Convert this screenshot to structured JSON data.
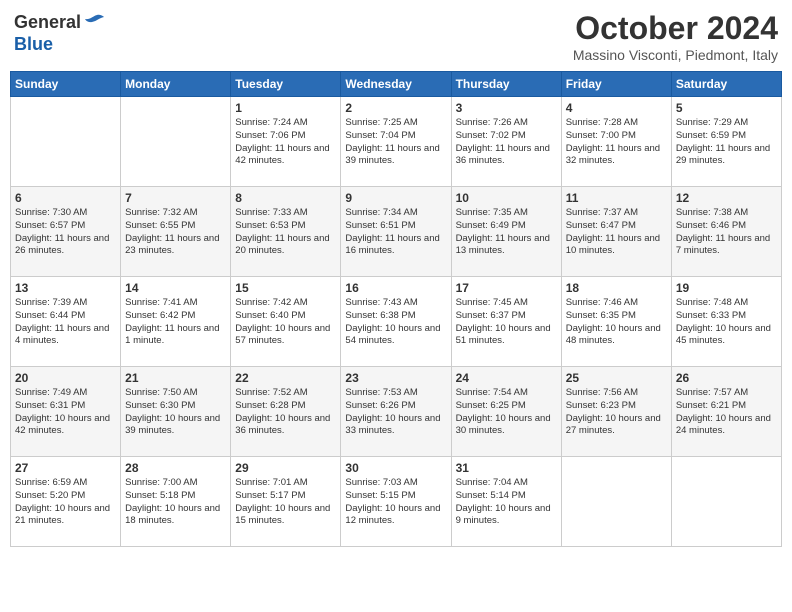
{
  "header": {
    "logo_general": "General",
    "logo_blue": "Blue",
    "month_title": "October 2024",
    "location": "Massino Visconti, Piedmont, Italy"
  },
  "weekdays": [
    "Sunday",
    "Monday",
    "Tuesday",
    "Wednesday",
    "Thursday",
    "Friday",
    "Saturday"
  ],
  "weeks": [
    [
      {
        "day": "",
        "info": ""
      },
      {
        "day": "",
        "info": ""
      },
      {
        "day": "1",
        "info": "Sunrise: 7:24 AM\nSunset: 7:06 PM\nDaylight: 11 hours and 42 minutes."
      },
      {
        "day": "2",
        "info": "Sunrise: 7:25 AM\nSunset: 7:04 PM\nDaylight: 11 hours and 39 minutes."
      },
      {
        "day": "3",
        "info": "Sunrise: 7:26 AM\nSunset: 7:02 PM\nDaylight: 11 hours and 36 minutes."
      },
      {
        "day": "4",
        "info": "Sunrise: 7:28 AM\nSunset: 7:00 PM\nDaylight: 11 hours and 32 minutes."
      },
      {
        "day": "5",
        "info": "Sunrise: 7:29 AM\nSunset: 6:59 PM\nDaylight: 11 hours and 29 minutes."
      }
    ],
    [
      {
        "day": "6",
        "info": "Sunrise: 7:30 AM\nSunset: 6:57 PM\nDaylight: 11 hours and 26 minutes."
      },
      {
        "day": "7",
        "info": "Sunrise: 7:32 AM\nSunset: 6:55 PM\nDaylight: 11 hours and 23 minutes."
      },
      {
        "day": "8",
        "info": "Sunrise: 7:33 AM\nSunset: 6:53 PM\nDaylight: 11 hours and 20 minutes."
      },
      {
        "day": "9",
        "info": "Sunrise: 7:34 AM\nSunset: 6:51 PM\nDaylight: 11 hours and 16 minutes."
      },
      {
        "day": "10",
        "info": "Sunrise: 7:35 AM\nSunset: 6:49 PM\nDaylight: 11 hours and 13 minutes."
      },
      {
        "day": "11",
        "info": "Sunrise: 7:37 AM\nSunset: 6:47 PM\nDaylight: 11 hours and 10 minutes."
      },
      {
        "day": "12",
        "info": "Sunrise: 7:38 AM\nSunset: 6:46 PM\nDaylight: 11 hours and 7 minutes."
      }
    ],
    [
      {
        "day": "13",
        "info": "Sunrise: 7:39 AM\nSunset: 6:44 PM\nDaylight: 11 hours and 4 minutes."
      },
      {
        "day": "14",
        "info": "Sunrise: 7:41 AM\nSunset: 6:42 PM\nDaylight: 11 hours and 1 minute."
      },
      {
        "day": "15",
        "info": "Sunrise: 7:42 AM\nSunset: 6:40 PM\nDaylight: 10 hours and 57 minutes."
      },
      {
        "day": "16",
        "info": "Sunrise: 7:43 AM\nSunset: 6:38 PM\nDaylight: 10 hours and 54 minutes."
      },
      {
        "day": "17",
        "info": "Sunrise: 7:45 AM\nSunset: 6:37 PM\nDaylight: 10 hours and 51 minutes."
      },
      {
        "day": "18",
        "info": "Sunrise: 7:46 AM\nSunset: 6:35 PM\nDaylight: 10 hours and 48 minutes."
      },
      {
        "day": "19",
        "info": "Sunrise: 7:48 AM\nSunset: 6:33 PM\nDaylight: 10 hours and 45 minutes."
      }
    ],
    [
      {
        "day": "20",
        "info": "Sunrise: 7:49 AM\nSunset: 6:31 PM\nDaylight: 10 hours and 42 minutes."
      },
      {
        "day": "21",
        "info": "Sunrise: 7:50 AM\nSunset: 6:30 PM\nDaylight: 10 hours and 39 minutes."
      },
      {
        "day": "22",
        "info": "Sunrise: 7:52 AM\nSunset: 6:28 PM\nDaylight: 10 hours and 36 minutes."
      },
      {
        "day": "23",
        "info": "Sunrise: 7:53 AM\nSunset: 6:26 PM\nDaylight: 10 hours and 33 minutes."
      },
      {
        "day": "24",
        "info": "Sunrise: 7:54 AM\nSunset: 6:25 PM\nDaylight: 10 hours and 30 minutes."
      },
      {
        "day": "25",
        "info": "Sunrise: 7:56 AM\nSunset: 6:23 PM\nDaylight: 10 hours and 27 minutes."
      },
      {
        "day": "26",
        "info": "Sunrise: 7:57 AM\nSunset: 6:21 PM\nDaylight: 10 hours and 24 minutes."
      }
    ],
    [
      {
        "day": "27",
        "info": "Sunrise: 6:59 AM\nSunset: 5:20 PM\nDaylight: 10 hours and 21 minutes."
      },
      {
        "day": "28",
        "info": "Sunrise: 7:00 AM\nSunset: 5:18 PM\nDaylight: 10 hours and 18 minutes."
      },
      {
        "day": "29",
        "info": "Sunrise: 7:01 AM\nSunset: 5:17 PM\nDaylight: 10 hours and 15 minutes."
      },
      {
        "day": "30",
        "info": "Sunrise: 7:03 AM\nSunset: 5:15 PM\nDaylight: 10 hours and 12 minutes."
      },
      {
        "day": "31",
        "info": "Sunrise: 7:04 AM\nSunset: 5:14 PM\nDaylight: 10 hours and 9 minutes."
      },
      {
        "day": "",
        "info": ""
      },
      {
        "day": "",
        "info": ""
      }
    ]
  ]
}
